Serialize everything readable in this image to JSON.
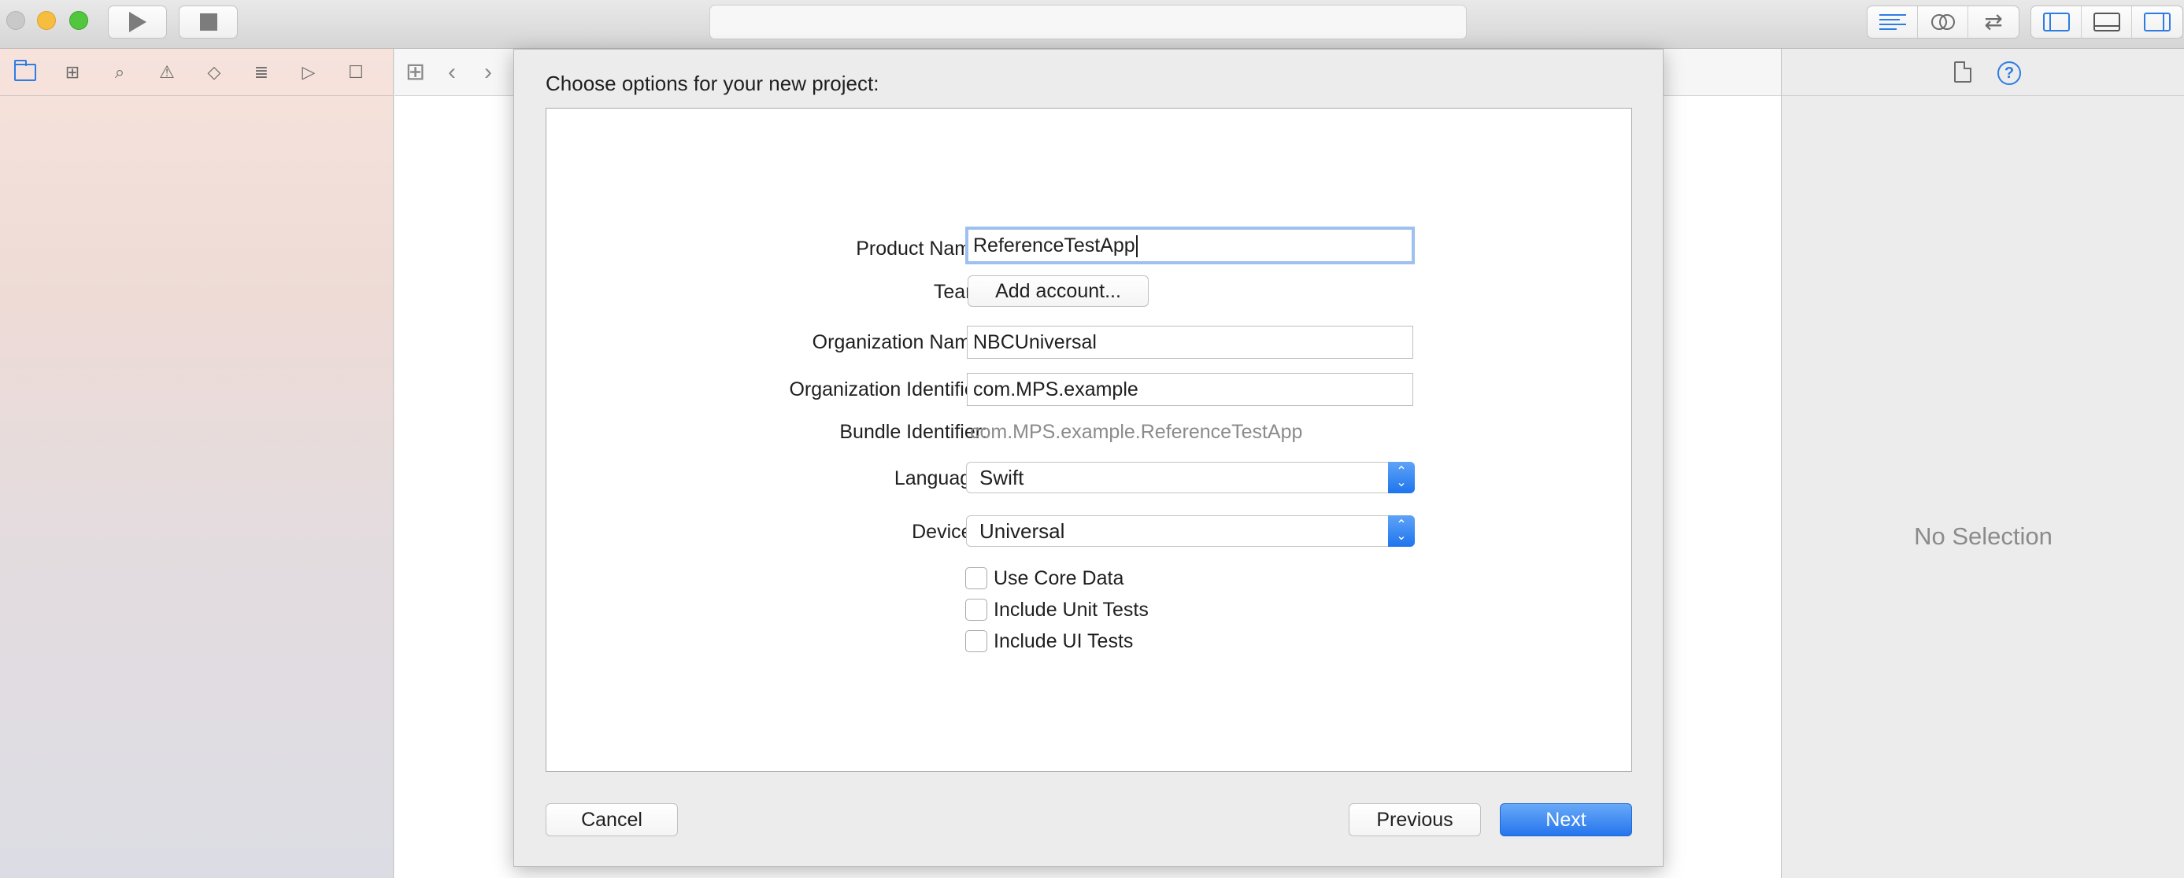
{
  "toolbar": {
    "run_icon": "play-icon",
    "stop_icon": "stop-icon",
    "editor_buttons": [
      "standard-editor-icon",
      "assistant-editor-icon",
      "version-editor-icon"
    ],
    "panel_buttons": [
      "navigator-toggle-icon",
      "debug-area-toggle-icon",
      "utilities-toggle-icon"
    ]
  },
  "navigator": {
    "tabs": [
      "project-navigator-icon",
      "symbol-navigator-icon",
      "find-navigator-icon",
      "issue-navigator-icon",
      "test-navigator-icon",
      "debug-navigator-icon",
      "breakpoint-navigator-icon",
      "report-navigator-icon"
    ]
  },
  "jump_bar": {
    "icons": [
      "related-items-icon",
      "back-arrow-icon",
      "forward-arrow-icon"
    ]
  },
  "inspector": {
    "tabs": [
      "file-inspector-icon",
      "quick-help-icon"
    ],
    "empty_text": "No Selection"
  },
  "dialog": {
    "title": "Choose options for your new project:",
    "product_name": {
      "label": "Product Name:",
      "value": "ReferenceTestApp"
    },
    "team": {
      "label": "Team:",
      "button": "Add account..."
    },
    "organization_name": {
      "label": "Organization Name:",
      "value": "NBCUniversal"
    },
    "organization_identifier": {
      "label": "Organization Identifier:",
      "value": "com.MPS.example"
    },
    "bundle_identifier": {
      "label": "Bundle Identifier:",
      "value": "com.MPS.example.ReferenceTestApp"
    },
    "language": {
      "label": "Language:",
      "value": "Swift"
    },
    "devices": {
      "label": "Devices:",
      "value": "Universal"
    },
    "checkboxes": [
      {
        "label": "Use Core Data",
        "checked": false
      },
      {
        "label": "Include Unit Tests",
        "checked": false
      },
      {
        "label": "Include UI Tests",
        "checked": false
      }
    ],
    "buttons": {
      "cancel": "Cancel",
      "previous": "Previous",
      "next": "Next"
    }
  },
  "colors": {
    "accent": "#2d7ce6",
    "next_button": "#2575ee",
    "focus_ring": "#9dc0ef"
  }
}
